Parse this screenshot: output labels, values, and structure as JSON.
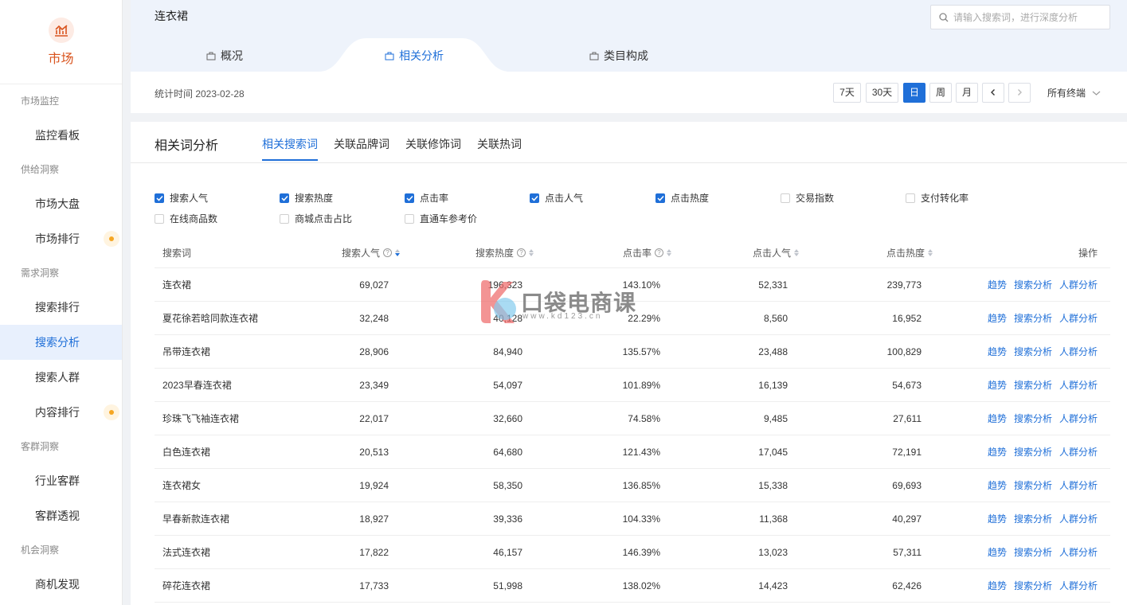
{
  "sidebar": {
    "brand": "市场",
    "sections": [
      {
        "group": "市场监控",
        "items": [
          "监控看板"
        ]
      },
      {
        "group": "供给洞察",
        "items": [
          "市场大盘",
          "市场排行"
        ]
      },
      {
        "group": "需求洞察",
        "items": [
          "搜索排行",
          "搜索分析",
          "搜索人群",
          "内容排行"
        ]
      },
      {
        "group": "客群洞察",
        "items": [
          "行业客群",
          "客群透视"
        ]
      },
      {
        "group": "机会洞察",
        "items": [
          "商机发现"
        ]
      }
    ],
    "active_item": "搜索分析"
  },
  "header": {
    "keyword": "连衣裙",
    "search_placeholder": "请输入搜索词，进行深度分析",
    "tabs": [
      "概况",
      "相关分析",
      "类目构成"
    ],
    "active_tab": "相关分析",
    "stat_time": "统计时间 2023-02-28",
    "ranges": [
      "7天",
      "30天",
      "日",
      "周",
      "月"
    ],
    "active_range": "日",
    "terminal": "所有终端"
  },
  "main": {
    "title": "相关词分析",
    "subtabs": [
      "相关搜索词",
      "关联品牌词",
      "关联修饰词",
      "关联热词"
    ],
    "active_subtab": "相关搜索词",
    "checkboxes": [
      {
        "label": "搜索人气",
        "checked": true
      },
      {
        "label": "搜索热度",
        "checked": true
      },
      {
        "label": "点击率",
        "checked": true
      },
      {
        "label": "点击人气",
        "checked": true
      },
      {
        "label": "点击热度",
        "checked": true
      },
      {
        "label": "交易指数",
        "checked": false
      },
      {
        "label": "支付转化率",
        "checked": false
      },
      {
        "label": "在线商品数",
        "checked": false
      },
      {
        "label": "商城点击占比",
        "checked": false
      },
      {
        "label": "直通车参考价",
        "checked": false
      }
    ],
    "table": {
      "headers": [
        "搜索词",
        "搜索人气",
        "搜索热度",
        "点击率",
        "点击人气",
        "点击热度",
        "操作"
      ],
      "ops": [
        "趋势",
        "搜索分析",
        "人群分析"
      ],
      "rows": [
        [
          "连衣裙",
          "69,027",
          "196,323",
          "143.10%",
          "52,331",
          "239,773"
        ],
        [
          "夏花徐若晗同款连衣裙",
          "32,248",
          "40,128",
          "22.29%",
          "8,560",
          "16,952"
        ],
        [
          "吊带连衣裙",
          "28,906",
          "84,940",
          "135.57%",
          "23,488",
          "100,829"
        ],
        [
          "2023早春连衣裙",
          "23,349",
          "54,097",
          "101.89%",
          "16,139",
          "54,673"
        ],
        [
          "珍珠飞飞袖连衣裙",
          "22,017",
          "32,660",
          "74.58%",
          "9,485",
          "27,611"
        ],
        [
          "白色连衣裙",
          "20,513",
          "64,680",
          "121.43%",
          "17,045",
          "72,191"
        ],
        [
          "连衣裙女",
          "19,924",
          "58,350",
          "136.85%",
          "15,338",
          "69,693"
        ],
        [
          "早春新款连衣裙",
          "18,927",
          "39,336",
          "104.33%",
          "11,368",
          "40,297"
        ],
        [
          "法式连衣裙",
          "17,822",
          "46,157",
          "146.39%",
          "13,023",
          "57,311"
        ],
        [
          "碎花连衣裙",
          "17,733",
          "51,998",
          "138.02%",
          "14,423",
          "62,426"
        ]
      ]
    }
  },
  "watermark": {
    "text": "口袋电商课",
    "url": "www.kd123.cn"
  },
  "colors": {
    "accent": "#1f6fd8",
    "brand": "#d9541e",
    "badge": "#f5a623"
  }
}
